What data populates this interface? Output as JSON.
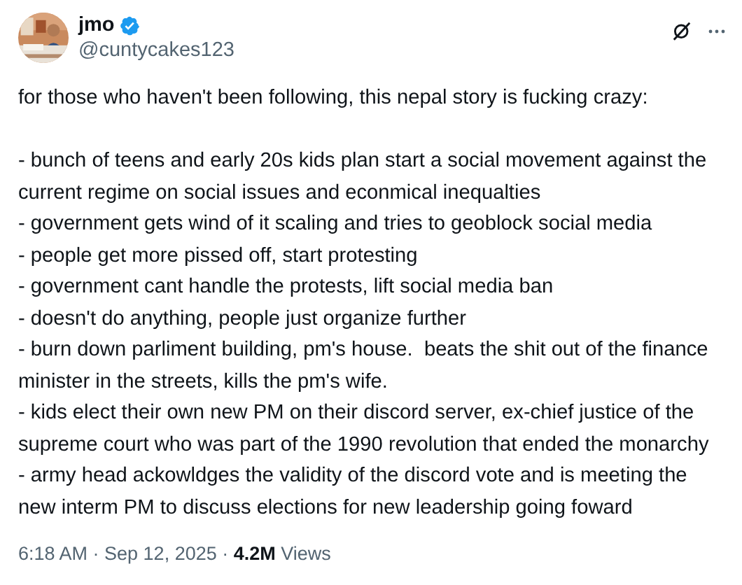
{
  "author": {
    "name": "jmo",
    "verified": true,
    "handle": "@cuntycakes123"
  },
  "body": {
    "intro": "for those who haven't been following, this nepal story is fucking crazy:",
    "items": [
      "- bunch of teens and early 20s kids plan start a social movement against the current regime on social issues and econmical inequalties",
      "- government gets wind of it scaling and tries to geoblock social media",
      "- people get more pissed off, start protesting",
      "- government cant handle the protests, lift social media ban",
      "- doesn't do anything, people just organize further",
      "- burn down parliment building, pm's house.  beats the shit out of the finance minister in the streets, kills the pm's wife.",
      "- kids elect their own new PM on their discord server, ex-chief justice of the supreme court who was part of the 1990 revolution that ended the monarchy",
      "- army head ackowldges the validity of the discord vote and is meeting the new interm PM to discuss elections for new leadership going foward"
    ]
  },
  "meta": "6:18 AM · Sep 12, 2025 · **4.2M** Views"
}
